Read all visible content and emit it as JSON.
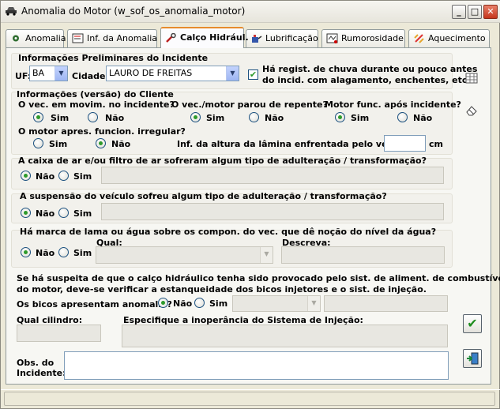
{
  "window": {
    "title": "Anomalia do Motor (w_sof_os_anomalia_motor)",
    "buttons": {
      "minimize": "_",
      "maximize": "□",
      "close": "✕"
    }
  },
  "tabs": [
    {
      "label": "Anomalia",
      "icon": "star-gear-icon"
    },
    {
      "label": "Inf. da Anomalia",
      "icon": "form-icon"
    },
    {
      "label": "Calço Hidrául.",
      "icon": "wrench-icon",
      "active": true
    },
    {
      "label": "Lubrificação",
      "icon": "oil-can-icon"
    },
    {
      "label": "Rumorosidade",
      "icon": "noise-icon"
    },
    {
      "label": "Aquecimento",
      "icon": "heat-icon"
    }
  ],
  "preliminary": {
    "title": "Informações Preliminares do Incidente",
    "uf_label": "UF:",
    "uf_value": "BA",
    "cidade_label": "Cidade:",
    "cidade_value": "LAURO DE FREITAS",
    "rain_checked": true,
    "rain_label_1": "Há regist. de chuva durante ou pouco antes",
    "rain_label_2": "do incid. com alagamento, enchentes, etc?"
  },
  "client": {
    "title": "Informações (versão) do Cliente",
    "q1": "O vec. em movim. no incidente?",
    "q2": "O vec./motor parou de repente?",
    "q3": "Motor func. após incidente?",
    "q4": "O motor apres. funcion. irregular?",
    "height_label": "Inf. da altura da lâmina enfrentada pelo veículo:",
    "height_value": "",
    "height_unit": "cm",
    "q1_answer": "Sim",
    "q2_answer": "Sim",
    "q3_answer": "Sim",
    "q4_answer": "Não"
  },
  "options": {
    "yes": "Sim",
    "no": "Não"
  },
  "air_filter": {
    "question": "A caixa de ar e/ou filtro de ar sofreram algum tipo de adulteração / transformação?",
    "answer": "Não",
    "details": ""
  },
  "suspension": {
    "question": "A suspensão do veículo sofreu algum tipo de adulteração / transformação?",
    "answer": "Não",
    "details": ""
  },
  "mud": {
    "question": "Há marca de lama ou água sobre os compon. do vec. que dê noção do nível da água?",
    "answer": "Não",
    "qual_label": "Qual:",
    "qual_value": "",
    "descreva_label": "Descreva:",
    "descreva_value": ""
  },
  "injection": {
    "text_1": "Se há suspeita de que o calço hidráulico tenha sido provocado pelo sist. de aliment. de combustível",
    "text_2": "do motor, deve-se verificar a estanqueidade dos bicos injetores e o sist. de injeção.",
    "bicos_label": "Os bicos apresentam anomalia?",
    "bicos_answer": "Não",
    "bicos_combo": "",
    "bicos_text": "",
    "cilindro_label": "Qual cilindro:",
    "cilindro_value": "",
    "inoperancia_label": "Especifique a inoperância do Sistema de Injeção:",
    "inoperancia_value": ""
  },
  "obs": {
    "label_1": "Obs. do",
    "label_2": "Incidente:",
    "value": ""
  },
  "side_buttons": [
    "grid-icon",
    "eraser-icon"
  ],
  "actions": {
    "confirm_icon": "checkmark-icon",
    "exit_icon": "exit-door-icon"
  },
  "colors": {
    "accent_tab": "#e68b2c",
    "radio_dot": "#2e9a2b",
    "confirm_green": "#1e8c1e"
  }
}
